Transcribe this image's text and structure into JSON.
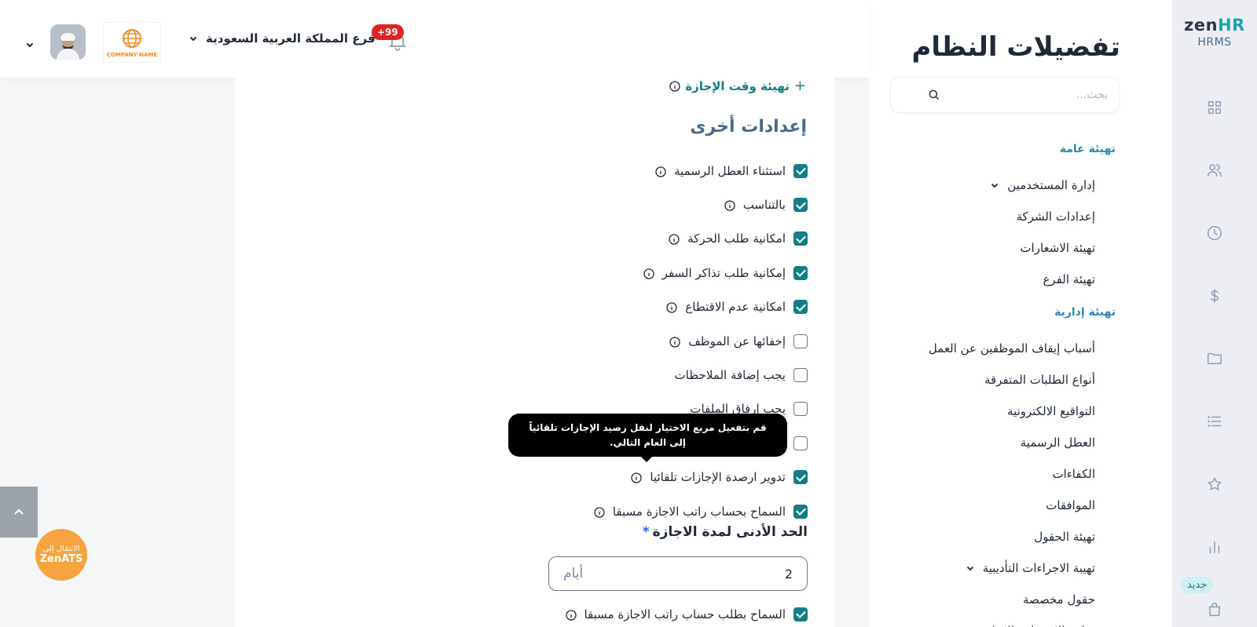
{
  "brand": {
    "logo_main": "zen",
    "logo_accent": "HR",
    "logo_sub": "HRMS"
  },
  "rail": {
    "icons": [
      "dashboard-icon",
      "users-icon",
      "clock-icon",
      "dollar-icon",
      "folder-icon",
      "list-icon",
      "star-icon",
      "chart-icon",
      "bag-icon"
    ],
    "new_badge": "جديد"
  },
  "panel": {
    "title": "تفضيلات النظام",
    "search_placeholder": "بحث...",
    "sections": [
      {
        "label": "تهيئة عامة"
      },
      {
        "label": "تهيئة إدارية"
      }
    ],
    "general_items": [
      {
        "label": "إدارة المستخدمين",
        "expandable": true
      },
      {
        "label": "إعدادات الشركة"
      },
      {
        "label": "تهيئة الاشعارات"
      },
      {
        "label": "تهيئة الفرع"
      }
    ],
    "admin_items": [
      {
        "label": "أسباب إيقاف الموظفين عن العمل"
      },
      {
        "label": "أنواع الطلبات المتفرقة"
      },
      {
        "label": "التواقيع الالكترونية"
      },
      {
        "label": "العطل الرسمية"
      },
      {
        "label": "الكفاءات"
      },
      {
        "label": "الموافقات"
      },
      {
        "label": "تهيئة الحقول"
      },
      {
        "label": "تهيبة الاجراءات التأديبية",
        "expandable": true
      },
      {
        "label": "حقول مخصصة"
      },
      {
        "label": "نماذج الانضمام والانهاء"
      }
    ]
  },
  "header": {
    "notifications_count": "+99",
    "branch_name": "فرع المملكة العربية السعودية",
    "company_logo_text": "COMPANY NAME"
  },
  "main": {
    "config_link": "تهيئة وقت الإجازة",
    "section_title": "إعدادات أخرى",
    "options": [
      {
        "label": "استثناء العطل الرسمية",
        "checked": true,
        "info": true
      },
      {
        "label": "بالتناسب",
        "checked": true,
        "info": true
      },
      {
        "label": "امكانية طلب الحركة",
        "checked": true,
        "info": true
      },
      {
        "label": "إمكانية طلب تذاكر السفر",
        "checked": true,
        "info": true
      },
      {
        "label": "امكانية عدم الاقتطاع",
        "checked": true,
        "info": true
      },
      {
        "label": "إخفائها عن الموظف",
        "checked": false,
        "info": true
      },
      {
        "label": "يجب إضافة الملاحظات",
        "checked": false,
        "info": false
      },
      {
        "label": "يجب إرفاق الملفات",
        "checked": false,
        "info": false
      },
      {
        "label": "",
        "checked": false,
        "info": false
      },
      {
        "label": "تدوير ارصدة الإجازات تلقائيا",
        "checked": true,
        "info": true
      },
      {
        "label": "السماح بحساب راتب الاجازة مسبقا",
        "checked": true,
        "info": true
      }
    ],
    "tooltip": "قم بتفعيل مربع الاختيار لنقل رصيد الإجازات تلقائياً إلى العام التالي.",
    "min_duration_label": "الحد الأدنى لمدة الاجازة",
    "required_mark": "*",
    "min_duration_value": "2",
    "min_duration_unit": "أيام",
    "last_option": {
      "label": "السماح بطلب حساب راتب الاجازة مسبقا",
      "checked": true,
      "info": true
    }
  },
  "floating": {
    "ats_line1": "الانتقال إلى",
    "ats_line2": "ZenATS"
  },
  "colors": {
    "accent": "#147d86",
    "section": "#2f87b0",
    "badge": "#e02424",
    "ats": "#f7a440"
  }
}
